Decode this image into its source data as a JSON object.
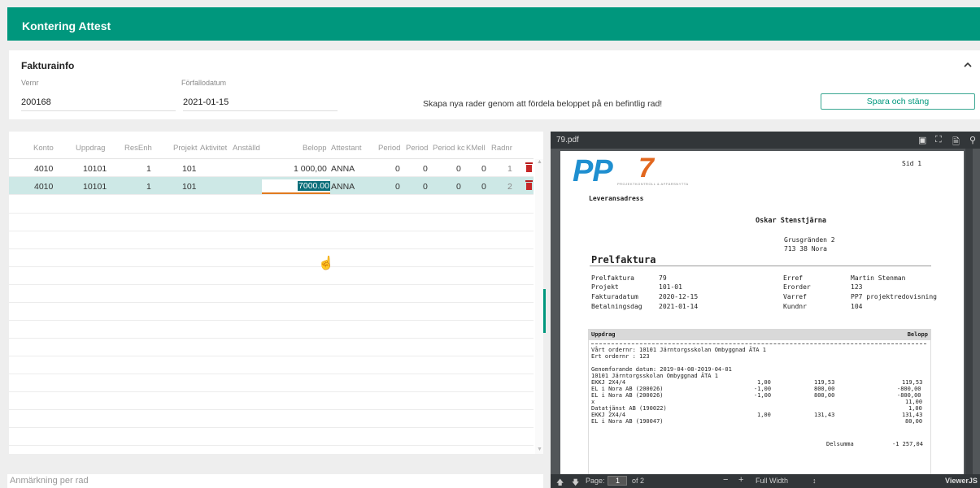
{
  "app": {
    "title": "Kontering Attest"
  },
  "fakturainfo": {
    "title": "Fakturainfo",
    "collapse_icon": "chevron-up-icon",
    "vernr_label": "Vernr",
    "vernr_value": "200168",
    "forfallo_label": "Förfallodatum",
    "forfallo_value": "2021-01-15",
    "message": "Skapa nya rader genom att fördela beloppet på en befintlig rad!",
    "save_button": "Spara och stäng"
  },
  "grid": {
    "columns": [
      "Konto",
      "Uppdrag",
      "ResEnh",
      "Projekt",
      "Aktivitet",
      "Anställd",
      "Belopp",
      "Attestant",
      "Period",
      "Period",
      "Period kc",
      "KMell",
      "Radnr"
    ],
    "rows": [
      {
        "konto": "4010",
        "uppdrag": "10101",
        "resenh": "1",
        "projekt": "101",
        "belopp": "1 000,00",
        "attestant": "ANNA",
        "p1": "0",
        "p2": "0",
        "p3": "0",
        "kmell": "0",
        "radnr": "1"
      },
      {
        "konto": "4010",
        "uppdrag": "10101",
        "resenh": "1",
        "projekt": "101",
        "belopp": "7000.00",
        "attestant": "ANNA",
        "p1": "0",
        "p2": "0",
        "p3": "0",
        "kmell": "0",
        "radnr": "2"
      }
    ],
    "note_placeholder": "Anmärkning per rad"
  },
  "viewer": {
    "filename": "79.pdf",
    "page_label": "Page:",
    "page_current": "1",
    "page_of": "of 2",
    "zoom": "Full Width",
    "brand": "ViewerJS"
  },
  "pdf": {
    "logo_text": "PP",
    "logo_seven": "7",
    "logo_sub": "PROJEKTKONTROLL & AFFÄRSNYTTA",
    "sid": "Sid 1",
    "leverans": "Leveransadress",
    "name": "Oskar Stenstjärna",
    "addr1": "Grusgränden 2",
    "addr2": "713 38 Nora",
    "heading": "Prelfaktura",
    "left_labels": [
      "Prelfaktura",
      "Projekt",
      "Fakturadatum",
      "Betalningsdag"
    ],
    "left_values": [
      "79",
      "101-01",
      "2020-12-15",
      "2021-01-14"
    ],
    "right_labels": [
      "Erref",
      "Erorder",
      "Varref",
      "Kundnr"
    ],
    "right_values": [
      "Martin Stenman",
      "123",
      "PP7 projektredovisning",
      "104"
    ],
    "col_uppdrag": "Uppdrag",
    "col_belopp": "Belopp",
    "lines": [
      "Vårt ordernr: 10101          Järntorgsskolan Ombyggnad ÄTA 1",
      "Ert ordernr : 123",
      "",
      "Genomforande datum: 2019-04-08-2019-04-01",
      "10101       Järntorgsskolan Ombyggnad ÄTA 1"
    ],
    "items": [
      {
        "desc": "EKKJ 2X4/4",
        "qty": "1,00",
        "price": "119,53",
        "sum": "119,53"
      },
      {
        "desc": "EL i Nora AB (200026)",
        "qty": "-1,00",
        "price": "800,00",
        "sum": "-800,00"
      },
      {
        "desc": "EL i Nora AB (200026)",
        "qty": "-1,00",
        "price": "800,00",
        "sum": "-800,00"
      },
      {
        "desc": "x",
        "qty": "",
        "price": "",
        "sum": "11,00"
      },
      {
        "desc": "Datatjänst AB (190022)",
        "qty": "",
        "price": "",
        "sum": "1,00"
      },
      {
        "desc": "EKKJ 2X4/4",
        "qty": "1,00",
        "price": "131,43",
        "sum": "131,43"
      },
      {
        "desc": "EL i Nora AB (190047)",
        "qty": "",
        "price": "",
        "sum": "80,00"
      }
    ],
    "delsumma_label": "Delsumma",
    "delsumma_value": "-1 257,04"
  }
}
